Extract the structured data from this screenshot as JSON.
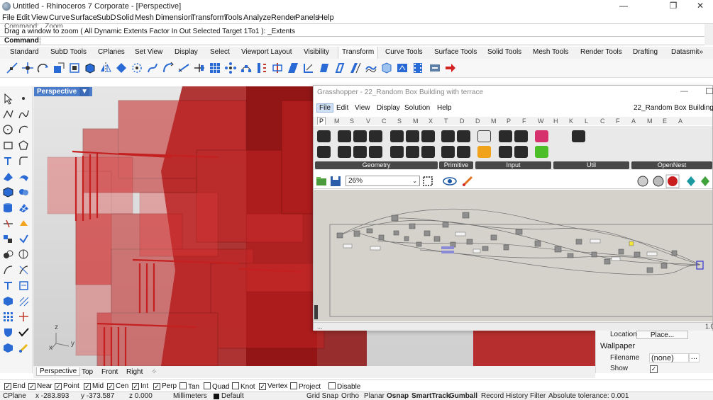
{
  "window": {
    "title": "Untitled - Rhinoceros 7 Corporate - [Perspective]",
    "min_glyph": "—",
    "max_glyph": "❐",
    "close_glyph": "✕"
  },
  "menu": [
    "File",
    "Edit",
    "View",
    "Curve",
    "Surface",
    "SubD",
    "Solid",
    "Mesh",
    "Dimension",
    "Transform",
    "Tools",
    "Analyze",
    "Render",
    "Panels",
    "Help"
  ],
  "command": {
    "history_prev": "Command: _Zoom",
    "history_last": "Drag a window to zoom ( All  Dynamic  Extents  Factor  In  Out  Selected  Target  1To1 ): _Extents",
    "prompt_label": "Command:",
    "value": ""
  },
  "toolbar_tabs": [
    "Standard",
    "SubD Tools",
    "CPlanes",
    "Set View",
    "Display",
    "Select",
    "Viewport Layout",
    "Visibility",
    "Transform",
    "Curve Tools",
    "Surface Tools",
    "Solid Tools",
    "Mesh Tools",
    "Render Tools",
    "Drafting",
    "Datasmit»"
  ],
  "active_toolbar_tab": "Transform",
  "viewport": {
    "name": "Perspective",
    "dropdown_glyph": "▼",
    "axis_z": "z",
    "axis_y": "y",
    "axis_x": "x",
    "tabs": [
      "Perspective",
      "Top",
      "Front",
      "Right"
    ],
    "add_tab_glyph": "✧"
  },
  "grasshopper": {
    "title": "Grasshopper - 22_Random Box Building with terrace",
    "menu": [
      "File",
      "Edit",
      "View",
      "Display",
      "Solution",
      "Help"
    ],
    "active_menu": "File",
    "document": "22_Random Box Building w",
    "component_tabs": [
      "P",
      "M",
      "S",
      "V",
      "C",
      "S",
      "M",
      "X",
      "T",
      "D",
      "D",
      "M",
      "P",
      "F",
      "W",
      "H",
      "K",
      "L",
      "C",
      "F",
      "A",
      "M",
      "E",
      "A"
    ],
    "groups": [
      "Geometry",
      "Primitive",
      "Input",
      "Util",
      "OpenNest"
    ],
    "zoom": "26%",
    "status_left": "...",
    "status_right": "1.0"
  },
  "properties": {
    "location_label": "Location",
    "place_button": "Place...",
    "wallpaper_heading": "Wallpaper",
    "filename_label": "Filename",
    "filename_value": "(none)",
    "browse_button": "...",
    "show_label": "Show",
    "show_checked": true
  },
  "osnap": [
    {
      "label": "End",
      "checked": true
    },
    {
      "label": "Near",
      "checked": true
    },
    {
      "label": "Point",
      "checked": true
    },
    {
      "label": "Mid",
      "checked": true
    },
    {
      "label": "Cen",
      "checked": true
    },
    {
      "label": "Int",
      "checked": true
    },
    {
      "label": "Perp",
      "checked": true
    },
    {
      "label": "Tan",
      "checked": false
    },
    {
      "label": "Quad",
      "checked": false
    },
    {
      "label": "Knot",
      "checked": false
    },
    {
      "label": "Vertex",
      "checked": true
    },
    {
      "label": "Project",
      "checked": false
    },
    {
      "label": "Disable",
      "checked": false
    }
  ],
  "status": {
    "cplane": "CPlane",
    "x": "x -283.893",
    "y": "y -373.587",
    "z": "z 0.000",
    "units": "Millimeters",
    "layer": "Default",
    "grid_snap": "Grid Snap",
    "ortho": "Ortho",
    "planar": "Planar",
    "osnap": "Osnap",
    "smarttrack": "SmartTrack",
    "gumball": "Gumball",
    "record_history": "Record History",
    "filter": "Filter",
    "tolerance": "Absolute tolerance: 0.001"
  }
}
